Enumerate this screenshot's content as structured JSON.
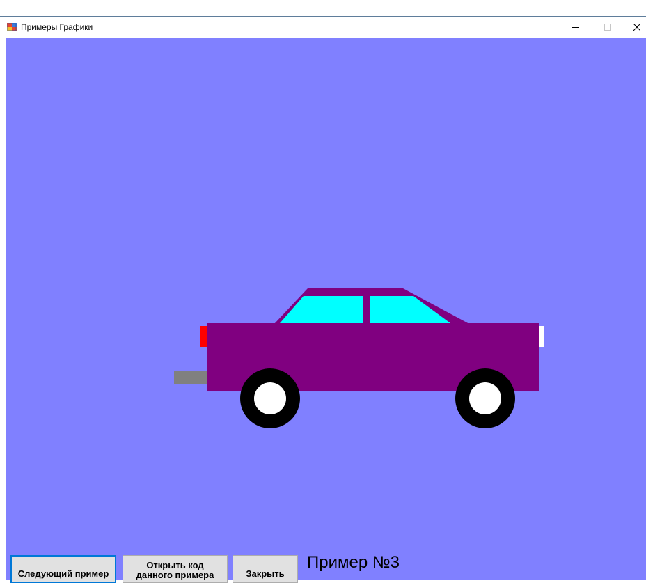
{
  "window": {
    "title": "Примеры Графики",
    "icon": "windows-form-icon",
    "controls": {
      "minimize_icon": "minimize-icon",
      "maximize_icon": "maximize-icon",
      "close_icon": "close-icon"
    }
  },
  "canvas": {
    "background_color": "#8080ff",
    "colors": {
      "body": "#800080",
      "windows": "#00ffff",
      "tail_light": "#ff0000",
      "head_light": "#ffffff",
      "exhaust": "#808080",
      "tire": "#000000",
      "hub": "#ffffff"
    }
  },
  "footer": {
    "next_button_label": "Следующий пример",
    "open_code_line1": "Открыть код",
    "open_code_line2": "данного примера",
    "close_button_label": "Закрыть",
    "example_label": "Пример №3"
  }
}
